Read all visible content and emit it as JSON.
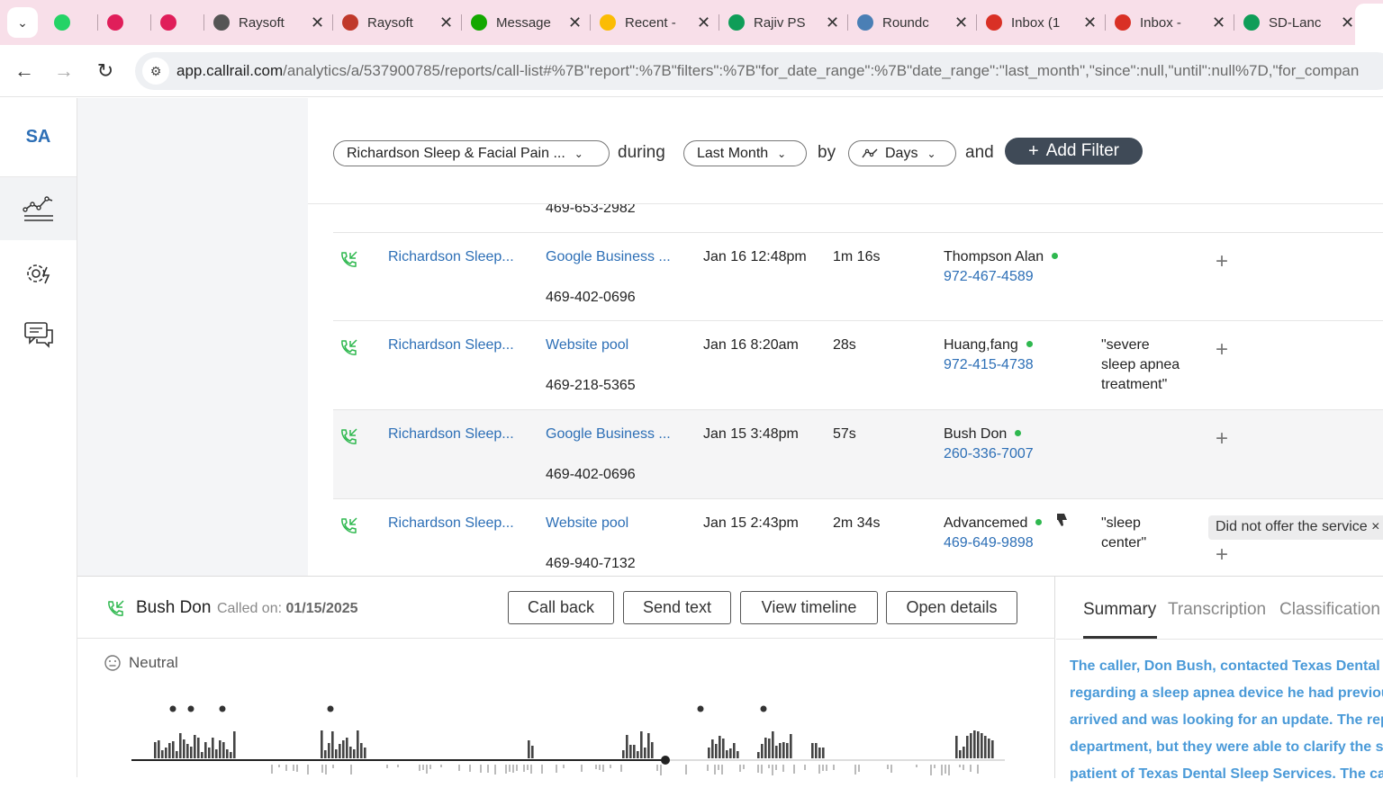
{
  "browser": {
    "tabs": [
      {
        "title": "",
        "icon": "whatsapp-icon",
        "color": "#25d366"
      },
      {
        "title": "",
        "icon": "slack-icon",
        "color": "#e01e5a"
      },
      {
        "title": "",
        "icon": "slack-icon",
        "color": "#e01e5a"
      },
      {
        "title": "Raysoft",
        "icon": "globe-icon",
        "color": "#555555"
      },
      {
        "title": "Raysoft",
        "icon": "raysoft-icon",
        "color": "#c0392b"
      },
      {
        "title": "Message",
        "icon": "upwork-icon",
        "color": "#14a800"
      },
      {
        "title": "Recent -",
        "icon": "google-drive-icon",
        "color": "#fbbc04"
      },
      {
        "title": "Rajiv PS",
        "icon": "google-sheets-icon",
        "color": "#0f9d58"
      },
      {
        "title": "Roundc",
        "icon": "roundcube-icon",
        "color": "#4a7fb5"
      },
      {
        "title": "Inbox (1",
        "icon": "gmail-icon",
        "color": "#d93025"
      },
      {
        "title": "Inbox -",
        "icon": "gmail-icon",
        "color": "#d93025"
      },
      {
        "title": "SD-Lanc",
        "icon": "google-sheets-icon",
        "color": "#0f9d58"
      }
    ],
    "url_host": "app.callrail.com",
    "url_path": "/analytics/a/537900785/reports/call-list#%7B\"report\":%7B\"filters\":%7B\"for_date_range\":%7B\"date_range\":\"last_month\",\"since\":null,\"until\":null%7D,\"for_compan"
  },
  "sidebar": {
    "avatar": "SA",
    "items": [
      {
        "icon": "analytics-chart-icon",
        "active": true
      },
      {
        "icon": "settings-gear-icon",
        "active": false
      },
      {
        "icon": "chat-bubbles-icon",
        "active": false
      }
    ]
  },
  "filters": {
    "company": "Richardson Sleep & Facial Pain ...",
    "during": "during",
    "date_range": "Last Month",
    "by": "by",
    "granularity": "Days",
    "and": "and",
    "add_filter": "Add Filter"
  },
  "calls": {
    "partial_number": "469-653-2982",
    "rows": [
      {
        "company": "Richardson Sleep...",
        "source": "Google Business ...",
        "tracking_number": "469-402-0696",
        "datetime": "Jan 16 12:48pm",
        "duration": "1m 16s",
        "caller": "Thompson Alan",
        "caller_phone": "972-467-4589",
        "keywords": [],
        "tag": ""
      },
      {
        "company": "Richardson Sleep...",
        "source": "Website pool",
        "tracking_number": "469-218-5365",
        "datetime": "Jan 16 8:20am",
        "duration": "28s",
        "caller": "Huang,fang",
        "caller_phone": "972-415-4738",
        "keywords": [
          "\"severe",
          "sleep apnea",
          "treatment\""
        ],
        "tag": ""
      },
      {
        "company": "Richardson Sleep...",
        "source": "Google Business ...",
        "tracking_number": "469-402-0696",
        "datetime": "Jan 15 3:48pm",
        "duration": "57s",
        "caller": "Bush Don",
        "caller_phone": "260-336-7007",
        "keywords": [],
        "tag": ""
      },
      {
        "company": "Richardson Sleep...",
        "source": "Website pool",
        "tracking_number": "469-940-7132",
        "datetime": "Jan 15 2:43pm",
        "duration": "2m 34s",
        "caller": "Advancemed",
        "caller_phone": "469-649-9898",
        "keywords": [
          "\"sleep",
          "center\""
        ],
        "tag": "Did not offer the service"
      }
    ]
  },
  "call_panel": {
    "caller": "Bush Don",
    "called_on_label": "Called on:",
    "called_on_date": "01/15/2025",
    "buttons": {
      "call_back": "Call back",
      "send_text": "Send text",
      "view_timeline": "View timeline",
      "open_details": "Open details"
    },
    "sentiment": "Neutral",
    "tabs": {
      "summary": "Summary",
      "transcription": "Transcription",
      "classification": "Classification"
    },
    "summary_lines": [
      "The caller, Don Bush, contacted Texas Dental Sl",
      "regarding a sleep apnea device he had previous",
      "arrived and was looking for an update. The rep",
      "department, but they were able to clarify the s",
      "patient of Texas Dental Sleep Services. The call"
    ]
  },
  "colors": {
    "accent_link": "#2d6fb6",
    "status_dot": "#2fb84f",
    "summary_text": "#4a9ad8",
    "add_filter_bg": "#3f4a57"
  }
}
